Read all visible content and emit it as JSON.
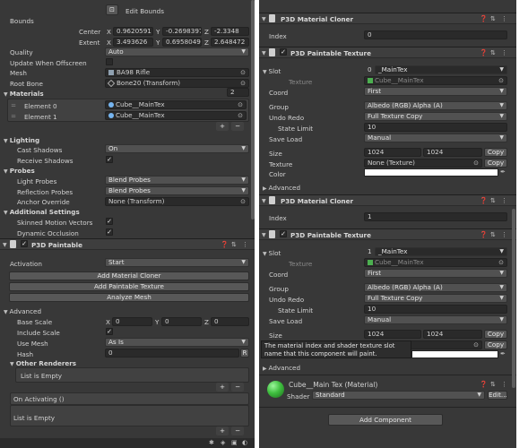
{
  "left": {
    "edit_bounds": "Edit Bounds",
    "bounds_label": "Bounds",
    "center_label": "Center",
    "extent_label": "Extent",
    "center": {
      "x": "0.9620591",
      "y": "-0.2698397",
      "z": "-2.3348"
    },
    "extent": {
      "x": "3.493626",
      "y": "0.6958049",
      "z": "2.648472"
    },
    "axis": {
      "x": "X",
      "y": "Y",
      "z": "Z"
    },
    "quality_label": "Quality",
    "quality_value": "Auto",
    "update_offscreen_label": "Update When Offscreen",
    "mesh_label": "Mesh",
    "mesh_value": "BA98 Rifle",
    "root_bone_label": "Root Bone",
    "root_bone_value": "Bone20 (Transform)",
    "materials_label": "Materials",
    "materials_count": "2",
    "materials": [
      {
        "label": "Element 0",
        "value": "Cube__MainTex"
      },
      {
        "label": "Element 1",
        "value": "Cube__MainTex"
      }
    ],
    "plus": "+",
    "minus": "−",
    "lighting_label": "Lighting",
    "cast_shadows_label": "Cast Shadows",
    "cast_shadows_value": "On",
    "receive_shadows_label": "Receive Shadows",
    "probes_label": "Probes",
    "light_probes_label": "Light Probes",
    "light_probes_value": "Blend Probes",
    "reflection_probes_label": "Reflection Probes",
    "reflection_probes_value": "Blend Probes",
    "anchor_override_label": "Anchor Override",
    "anchor_override_value": "None (Transform)",
    "additional_settings_label": "Additional Settings",
    "skinned_motion_label": "Skinned Motion Vectors",
    "dynamic_occlusion_label": "Dynamic Occlusion",
    "paintable_title": "P3D Paintable",
    "activation_label": "Activation",
    "activation_value": "Start",
    "add_material_cloner": "Add Material Cloner",
    "add_paintable_texture": "Add Paintable Texture",
    "analyze_mesh": "Analyze Mesh",
    "advanced_label": "Advanced",
    "base_scale_label": "Base Scale",
    "base_scale": {
      "x": "0",
      "y": "0",
      "z": "0"
    },
    "include_scale_label": "Include Scale",
    "use_mesh_label": "Use Mesh",
    "use_mesh_value": "As Is",
    "hash_label": "Hash",
    "hash_value": "0",
    "hash_btn": "R",
    "other_renderers_label": "Other Renderers",
    "list_empty": "List is Empty",
    "on_activating_label": "On Activating ()",
    "list_empty_2": "List is Empty"
  },
  "right": {
    "cloner1": {
      "title": "P3D Material Cloner",
      "index_label": "Index",
      "index_value": "0"
    },
    "texture1": {
      "title": "P3D Paintable Texture",
      "slot_label": "Slot",
      "slot_index": "0",
      "slot_name": "_MainTex",
      "texture_label": "Texture",
      "texture_value": "Cube__MainTex",
      "coord_label": "Coord",
      "coord_value": "First",
      "group_label": "Group",
      "group_value": "Albedo (RGB) Alpha (A)",
      "undo_redo_label": "Undo Redo",
      "undo_redo_value": "Full Texture Copy",
      "state_limit_label": "State Limit",
      "state_limit_value": "10",
      "save_load_label": "Save Load",
      "save_load_value": "Manual",
      "size_label": "Size",
      "size_w": "1024",
      "size_h": "1024",
      "copy": "Copy",
      "texture2_label": "Texture",
      "texture2_value": "None (Texture)",
      "copy2": "Copy",
      "color_label": "Color",
      "advanced_label": "Advanced"
    },
    "cloner2": {
      "title": "P3D Material Cloner",
      "index_label": "Index",
      "index_value": "1"
    },
    "texture2": {
      "title": "P3D Paintable Texture",
      "slot_label": "Slot",
      "slot_index": "1",
      "slot_name": "_MainTex",
      "texture_label": "Texture",
      "texture_value": "Cube__MainTex",
      "coord_label": "Coord",
      "coord_value": "First",
      "group_label": "Group",
      "group_value": "Albedo (RGB) Alpha (A)",
      "undo_redo_label": "Undo Redo",
      "undo_redo_value": "Full Texture Copy",
      "state_limit_label": "State Limit",
      "state_limit_value": "10",
      "save_load_label": "Save Load",
      "save_load_value": "Manual",
      "size_label": "Size",
      "size_w": "1024",
      "size_h": "1024",
      "copy": "Copy",
      "copy2": "Copy",
      "tooltip": "The material index and shader texture slot name that this component will paint.",
      "advanced_label": "Advanced"
    },
    "material": {
      "name": "Cube__Main Tex (Material)",
      "shader_label": "Shader",
      "shader_value": "Standard",
      "edit": "Edit..."
    },
    "add_component": "Add Component"
  },
  "colors": {
    "panel": "#383838",
    "field": "#2a2a2a",
    "button": "#585858",
    "material_ball": "#3fbf3f"
  }
}
